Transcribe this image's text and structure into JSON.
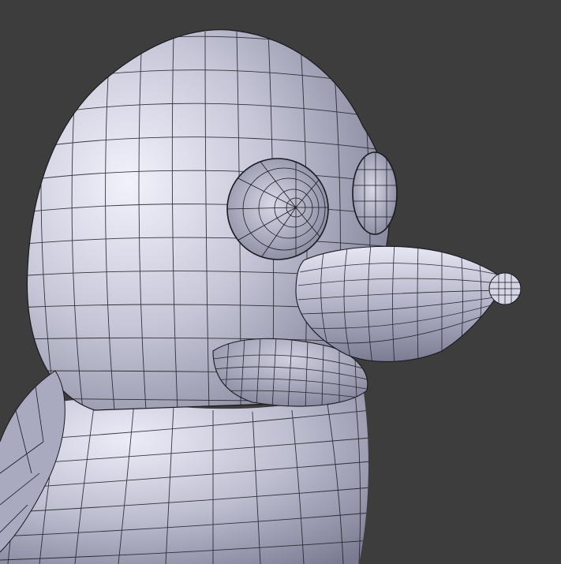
{
  "viewport": {
    "background": "#3d3d3d",
    "mesh": {
      "surface_color": "#b7b7c9",
      "highlight_color": "#eeeefa",
      "shadow_color": "#6f6f85",
      "wire_color": "#1a1a22"
    }
  }
}
